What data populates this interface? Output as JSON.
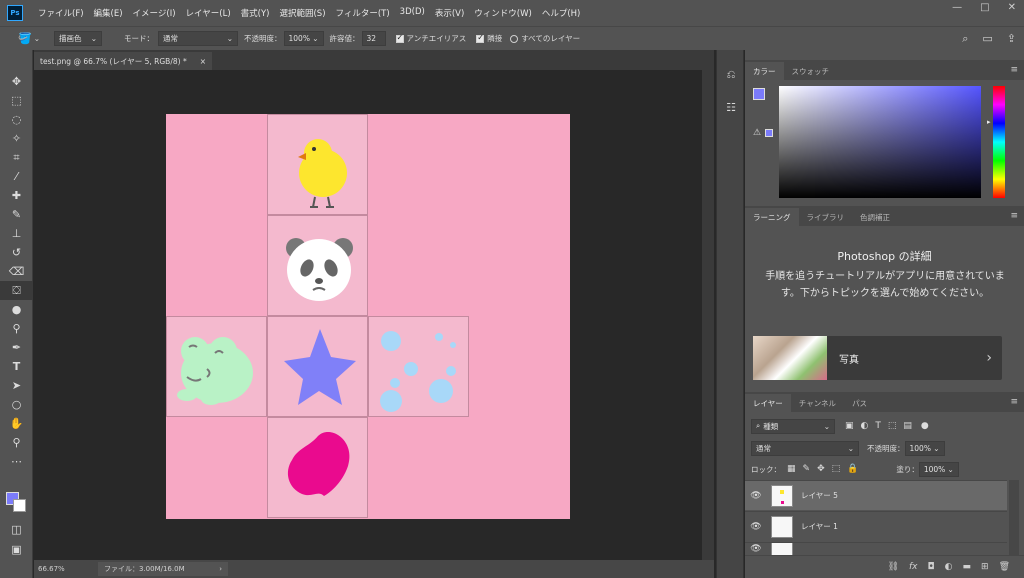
{
  "menubar": {
    "logo": "Ps",
    "items": [
      "ファイル(F)",
      "編集(E)",
      "イメージ(I)",
      "レイヤー(L)",
      "書式(Y)",
      "選択範囲(S)",
      "フィルター(T)",
      "3D(D)",
      "表示(V)",
      "ウィンドウ(W)",
      "ヘルプ(H)"
    ],
    "window_controls": [
      "—",
      "□",
      "✕"
    ]
  },
  "options": {
    "fill_source": "描画色",
    "mode_label": "モード：",
    "mode_value": "通常",
    "opacity_label": "不透明度：",
    "opacity_value": "100%",
    "tolerance_label": "許容値：",
    "tolerance_value": "32",
    "antialias_label": "アンチエイリアス",
    "antialias_checked": true,
    "contiguous_label": "隣接",
    "contiguous_checked": true,
    "all_layers_label": "すべてのレイヤー",
    "all_layers_checked": false
  },
  "document": {
    "tab_title": "test.png @ 66.7% (レイヤー 5, RGB/8) *",
    "tab_close": "×",
    "zoom": "66.67%",
    "file_info": "ファイル：3.00M/16.0M",
    "status_arrow": "›"
  },
  "canvas": {
    "background_color": "#f7a8c4",
    "cell_color": "#f4b9ce",
    "stickers": [
      "chick",
      "panda",
      "frog",
      "star",
      "polka-dots",
      "heart"
    ]
  },
  "toolbar": {
    "foreground_color": "#7b7bfa",
    "background_color": "#ffffff",
    "tools": [
      "move-icon",
      "marquee-icon",
      "lasso-icon",
      "magic-wand-icon",
      "crop-icon",
      "eyedropper-icon",
      "healing-brush-icon",
      "brush-icon",
      "clone-stamp-icon",
      "history-brush-icon",
      "eraser-icon",
      "paint-bucket-icon",
      "blur-icon",
      "dodge-icon",
      "pen-icon",
      "type-icon",
      "path-selection-icon",
      "ellipse-icon",
      "hand-icon",
      "zoom-icon",
      "more-icon"
    ],
    "active_tool": "paint-bucket-icon"
  },
  "color_panel": {
    "tabs": [
      "カラー",
      "スウォッチ"
    ],
    "foreground_color": "#7b7bfa"
  },
  "learn_panel": {
    "tabs": [
      "ラーニング",
      "ライブラリ",
      "色調補正"
    ],
    "title": "Photoshop の詳細",
    "description": "手順を追うチュートリアルがアプリに用意されています。下からトピックを選んで始めてください。",
    "card_label": "写真",
    "card_chevron": "›"
  },
  "layers_panel": {
    "tabs": [
      "レイヤー",
      "チャンネル",
      "パス"
    ],
    "filter_label": "種類",
    "blend_mode": "通常",
    "opacity_label": "不透明度：",
    "opacity_value": "100%",
    "lock_label": "ロック：",
    "fill_label": "塗り：",
    "fill_value": "100%",
    "layers": [
      {
        "name": "レイヤー 5",
        "visible": true,
        "selected": true
      },
      {
        "name": "レイヤー 1",
        "visible": true,
        "selected": false
      },
      {
        "name": "",
        "visible": true,
        "selected": false
      }
    ],
    "footer_icons": [
      "link-icon",
      "fx-icon",
      "mask-icon",
      "adjustment-icon",
      "group-icon",
      "new-layer-icon",
      "trash-icon"
    ]
  }
}
